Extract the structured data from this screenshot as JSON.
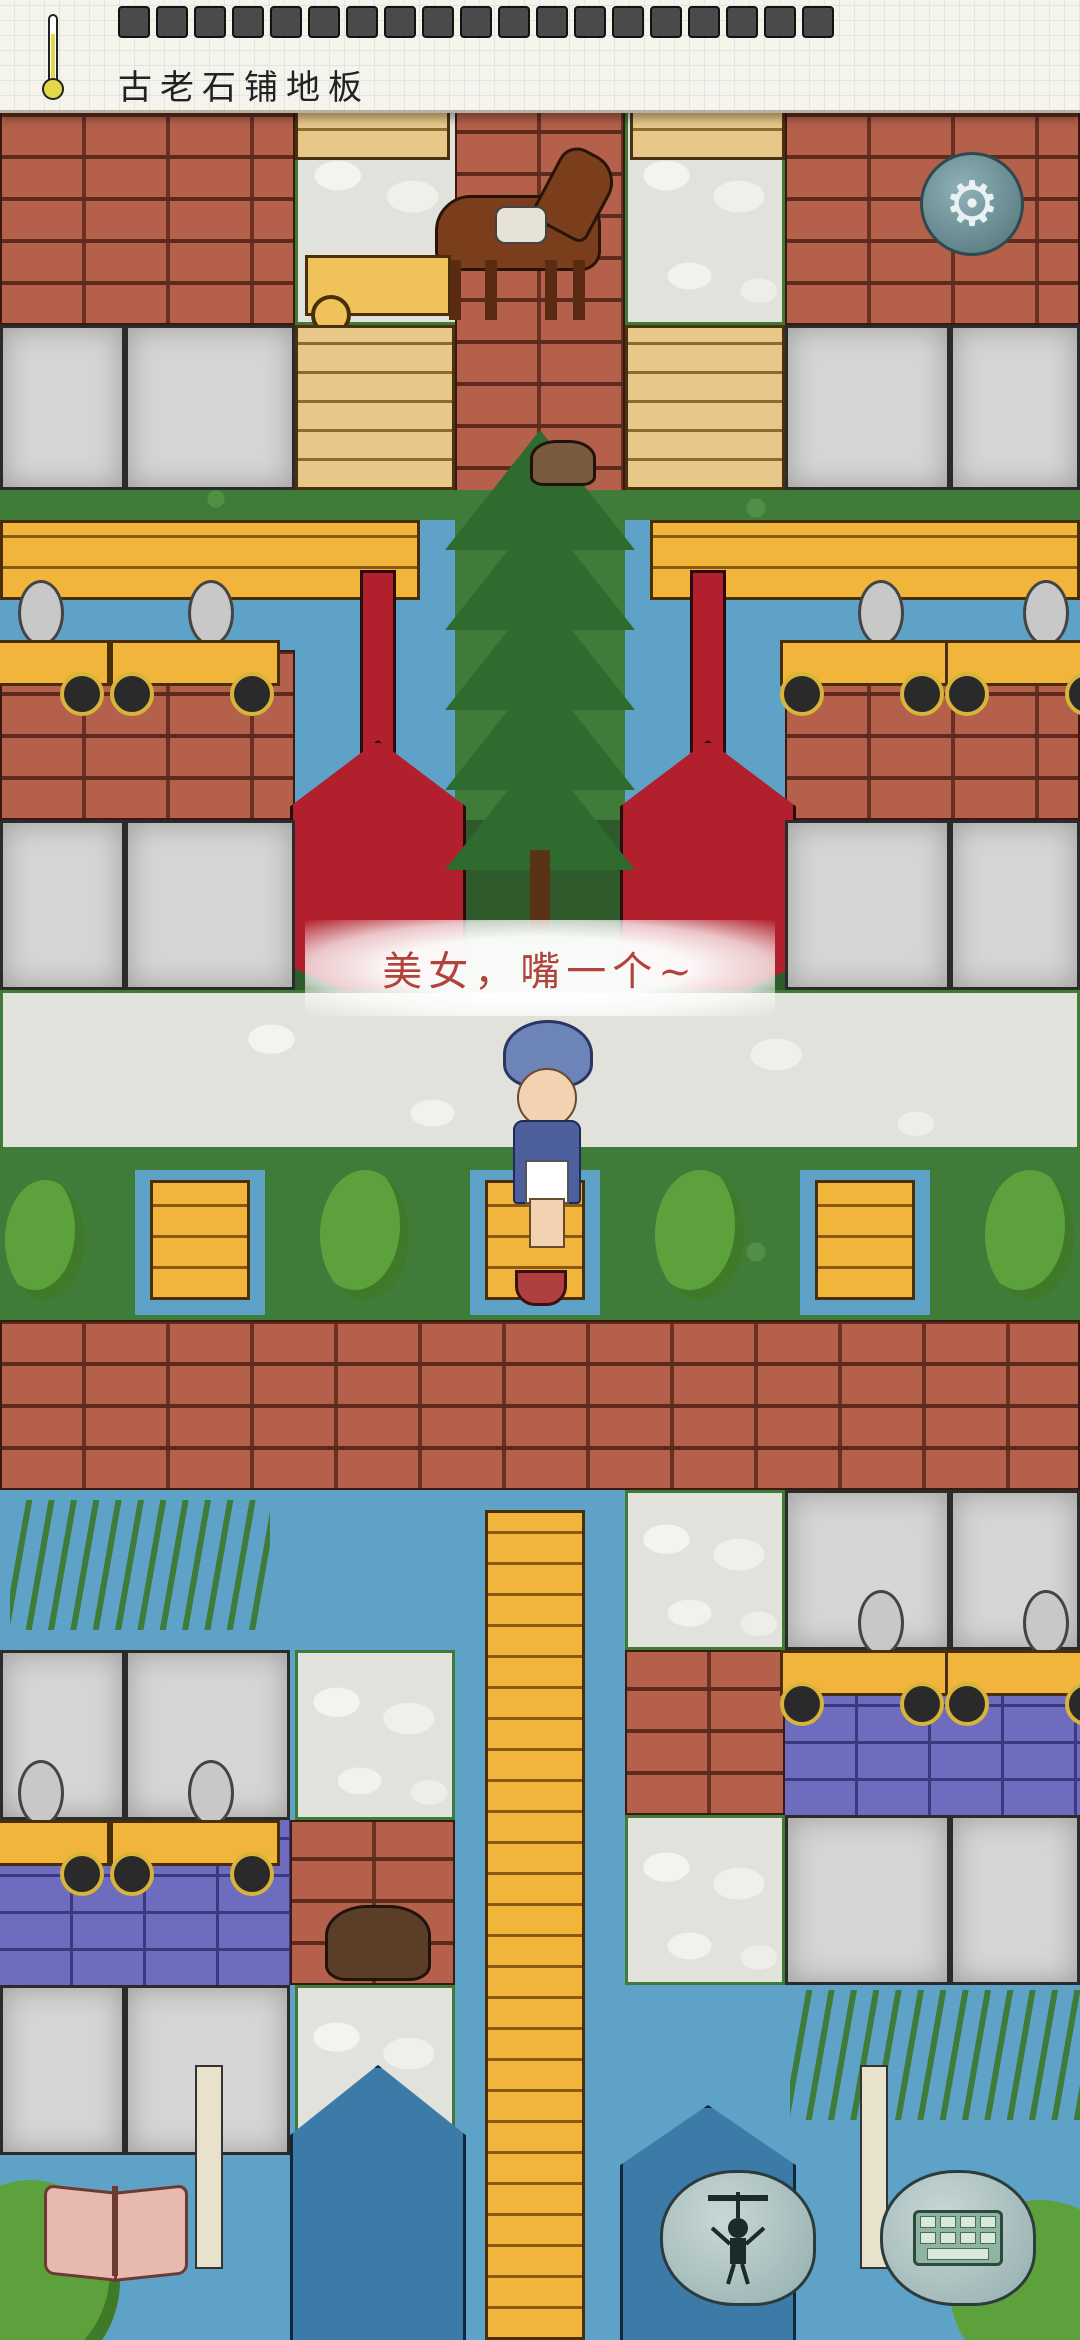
{
  "hud": {
    "floor_label": "古老石铺地板",
    "thermometer": "thermometer-icon",
    "inventory_tile_count": 19
  },
  "speech": {
    "text": "美女，嘴一个~"
  },
  "buttons": {
    "settings": "gear-icon",
    "book": "book-icon",
    "emote": "puppet-icon",
    "keyboard": "keyboard-icon"
  },
  "colors": {
    "brick": "#b4604a",
    "water": "#5fa2c8",
    "grass": "#3f7c39",
    "plank": "#f0b53a",
    "speech_text": "#b0433b",
    "hud_bg": "#f6f3ea"
  }
}
